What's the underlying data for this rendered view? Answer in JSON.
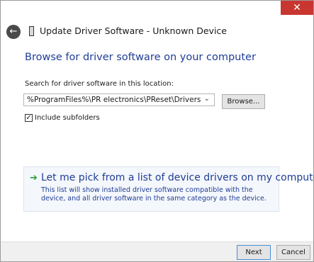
{
  "window": {
    "close_glyph": "✕"
  },
  "header": {
    "back_glyph": "←",
    "title": "Update Driver Software - Unknown Device"
  },
  "main": {
    "heading": "Browse for driver software on your computer",
    "search_label": "Search for driver software in this location:",
    "path_value": "%ProgramFiles%\\PR electronics\\PReset\\Drivers",
    "chevron_glyph": "⌄",
    "browse_label": "Browse...",
    "include_subfolders": {
      "label": "Include subfolders",
      "checked": true,
      "check_glyph": "✓"
    },
    "pick": {
      "arrow_glyph": "➔",
      "title": "Let me pick from a list of device drivers on my computer",
      "description": "This list will show installed driver software compatible with the device, and all driver software in the same category as the device."
    }
  },
  "footer": {
    "next_label": "Next",
    "cancel_label": "Cancel"
  },
  "colors": {
    "accent_text": "#1f3d96",
    "close_red": "#c7372f",
    "arrow_green": "#2e9e3a"
  }
}
